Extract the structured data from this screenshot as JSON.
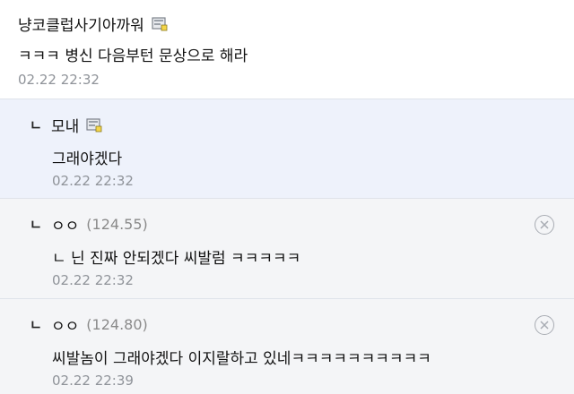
{
  "comments": [
    {
      "nick": "냥코클럽사기아까워",
      "text": "ㅋㅋㅋ 병신 다음부턴 문상으로 해라",
      "date": "02.22 22:32",
      "icon": "memo-icon"
    },
    {
      "reply_mark": "ㄴ",
      "nick": "모내",
      "text": "그래야겠다",
      "date": "02.22 22:32",
      "icon": "memo-icon"
    },
    {
      "reply_mark": "ㄴ",
      "nick": "ㅇㅇ",
      "ip": "(124.55)",
      "text": "ㄴ 닌 진짜 안되겠다 씨발럼 ㅋㅋㅋㅋㅋ",
      "date": "02.22 22:32",
      "delete_icon": "close-circle-icon"
    },
    {
      "reply_mark": "ㄴ",
      "nick": "ㅇㅇ",
      "ip": "(124.80)",
      "text": "씨발놈이 그래야겠다 이지랄하고 있네ㅋㅋㅋㅋㅋㅋㅋㅋㅋㅋ",
      "date": "02.22 22:39",
      "delete_icon": "close-circle-icon"
    }
  ],
  "colors": {
    "reply_bg_own": "#eef2fb",
    "reply_bg_other": "#f4f5f7",
    "date_text": "#8f9399",
    "ip_text": "#8a8a8a"
  }
}
